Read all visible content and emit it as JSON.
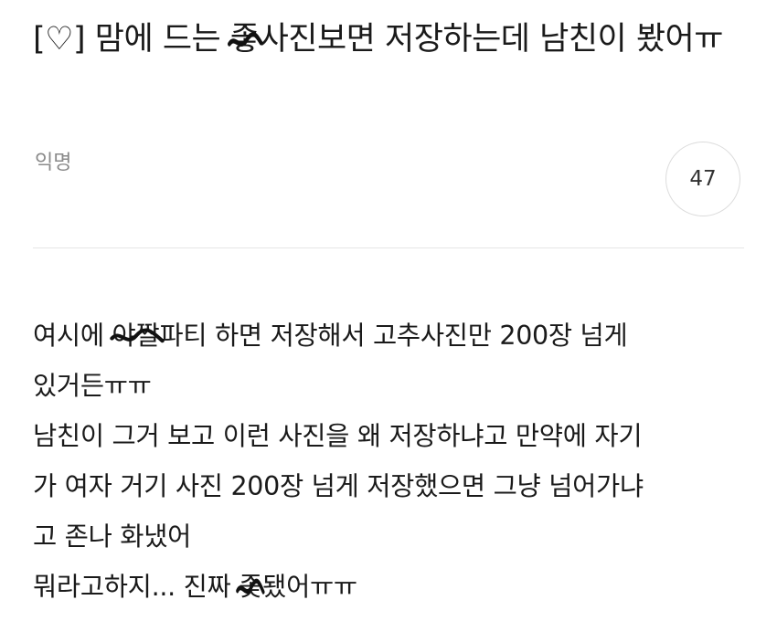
{
  "post": {
    "title": {
      "before": "[♡] 맘에 드는 ",
      "censored": "좋",
      "after": "사진보면 저장하는데 남친이 봤어ㅠ"
    },
    "author": "익명",
    "comment_count": "47",
    "body": {
      "line1_before": "여시에 ",
      "line1_censored": "야짤",
      "line1_after": "파티 하면 저장해서 고추사진만 200장 넘게",
      "line2": "있거든ㅠㅠ",
      "line3": "남친이 그거 보고 이런 사진을 왜 저장하냐고 만약에 자기",
      "line4": "가 여자 거기 사진 200장 넘게 저장했으면 그냥 넘어가냐",
      "line5": "고 존나 화냈어",
      "line6_before": "뭐라고하지... 진짜 ",
      "line6_censored": "좆",
      "line6_after": "됐어ㅠㅠ"
    }
  }
}
